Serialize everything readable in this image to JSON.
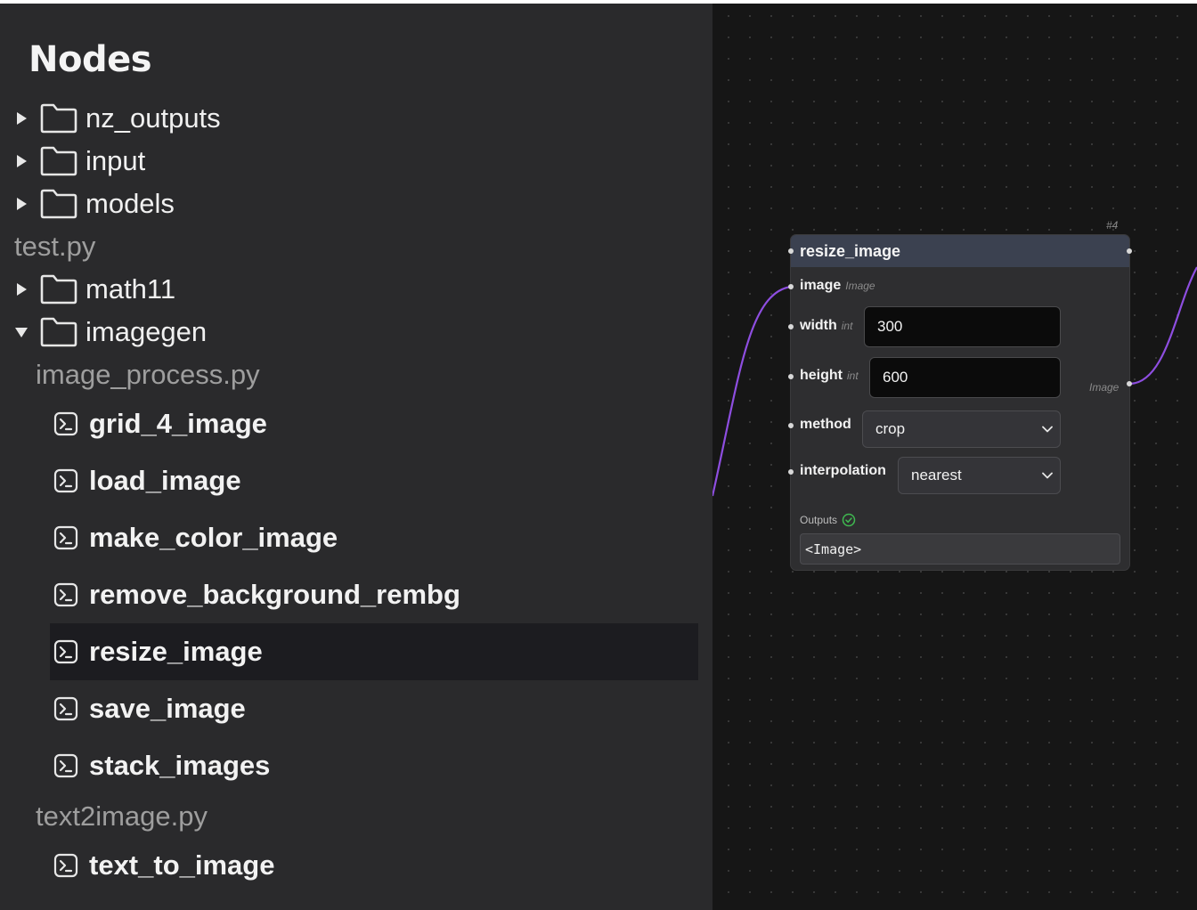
{
  "sidebar": {
    "title": "Nodes",
    "folders_top": [
      {
        "label": "nz_outputs",
        "expanded": false
      },
      {
        "label": "input",
        "expanded": false
      },
      {
        "label": "models",
        "expanded": false
      }
    ],
    "file_test": "test.py",
    "folder_math": {
      "label": "math11",
      "expanded": false
    },
    "folder_imagegen": {
      "label": "imagegen",
      "expanded": true
    },
    "file_image_process": "image_process.py",
    "image_process_functions": [
      {
        "label": "grid_4_image",
        "selected": false
      },
      {
        "label": "load_image",
        "selected": false
      },
      {
        "label": "make_color_image",
        "selected": false
      },
      {
        "label": "remove_background_rembg",
        "selected": false
      },
      {
        "label": "resize_image",
        "selected": true
      },
      {
        "label": "save_image",
        "selected": false
      },
      {
        "label": "stack_images",
        "selected": false
      }
    ],
    "file_text2image": "text2image.py",
    "text2image_functions": [
      {
        "label": "text_to_image",
        "selected": false
      }
    ]
  },
  "node": {
    "id": "#4",
    "title": "resize_image",
    "params": {
      "image": {
        "name": "image",
        "type": "Image"
      },
      "width": {
        "name": "width",
        "type": "int",
        "value": "300"
      },
      "height": {
        "name": "height",
        "type": "int",
        "value": "600"
      },
      "method": {
        "name": "method",
        "value": "crop"
      },
      "interpolation": {
        "name": "interpolation",
        "value": "nearest"
      }
    },
    "output_type": "Image",
    "outputs_label": "Outputs",
    "output_value": "<Image>"
  },
  "colors": {
    "sidebar_bg": "#2a2a2c",
    "canvas_bg": "#161616",
    "node_header": "#3b4150",
    "edge": "#8e4ee0",
    "status_ok": "#3fb950"
  }
}
